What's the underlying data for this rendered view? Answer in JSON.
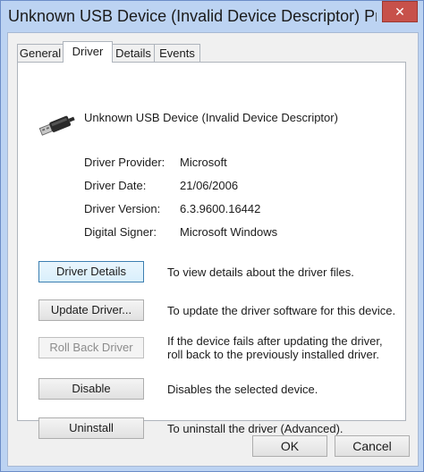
{
  "window": {
    "title": "Unknown USB Device (Invalid Device Descriptor) Pro...",
    "close_glyph": "✕"
  },
  "tabs": [
    {
      "label": "General"
    },
    {
      "label": "Driver"
    },
    {
      "label": "Details"
    },
    {
      "label": "Events"
    }
  ],
  "device": {
    "name": "Unknown USB Device (Invalid Device Descriptor)",
    "icon": "usb-plug-icon"
  },
  "properties": [
    {
      "label": "Driver Provider:",
      "value": "Microsoft"
    },
    {
      "label": "Driver Date:",
      "value": "21/06/2006"
    },
    {
      "label": "Driver Version:",
      "value": "6.3.9600.16442"
    },
    {
      "label": "Digital Signer:",
      "value": "Microsoft Windows"
    }
  ],
  "actions": [
    {
      "button": "Driver Details",
      "description": "To view details about the driver files."
    },
    {
      "button": "Update Driver...",
      "description": "To update the driver software for this device."
    },
    {
      "button": "Roll Back Driver",
      "description": "If the device fails after updating the driver, roll back to the previously installed driver."
    },
    {
      "button": "Disable",
      "description": "Disables the selected device."
    },
    {
      "button": "Uninstall",
      "description": "To uninstall the driver (Advanced)."
    }
  ],
  "footer": {
    "ok": "OK",
    "cancel": "Cancel"
  },
  "colors": {
    "title_bar": "#bcd3f2",
    "close_button": "#c7514a"
  }
}
